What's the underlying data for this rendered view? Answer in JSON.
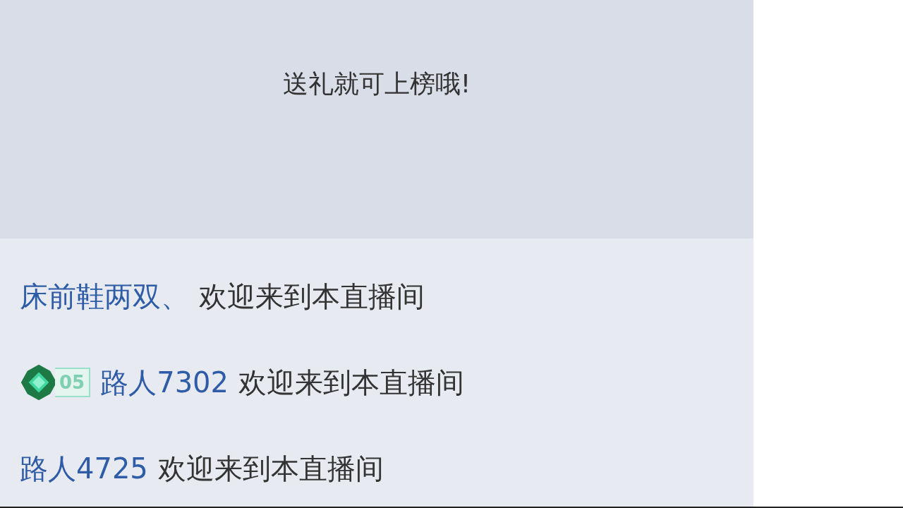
{
  "rank_panel": {
    "empty_text": "送礼就可上榜哦!"
  },
  "chat_messages": [
    {
      "user": "床前鞋两双、",
      "text": "欢迎来到本直播间"
    },
    {
      "badge": {
        "level": "05"
      },
      "user": "路人7302",
      "text": "欢迎来到本直播间"
    },
    {
      "user": "路人4725",
      "text": "欢迎来到本直播间"
    }
  ]
}
